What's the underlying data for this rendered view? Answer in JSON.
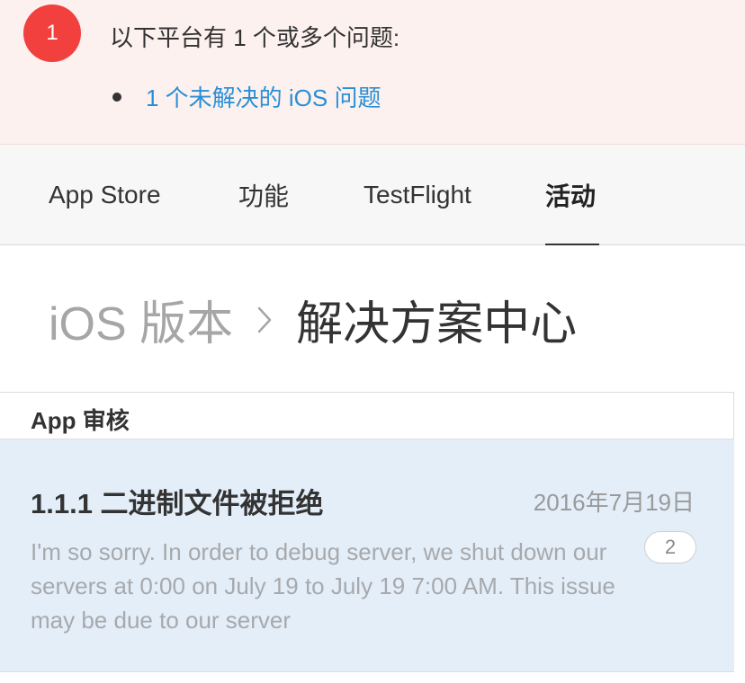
{
  "alert": {
    "badge_count": "1",
    "title": "以下平台有 1 个或多个问题:",
    "items": [
      {
        "label": "1 个未解决的 iOS 问题"
      }
    ]
  },
  "tabs": [
    {
      "label": "App Store",
      "active": false
    },
    {
      "label": "功能",
      "active": false
    },
    {
      "label": "TestFlight",
      "active": false
    },
    {
      "label": "活动",
      "active": true
    }
  ],
  "breadcrumb": {
    "parent": "iOS 版本",
    "current": "解决方案中心"
  },
  "section": {
    "title": "App 审核",
    "messages": [
      {
        "title": "1.1.1 二进制文件被拒绝",
        "date": "2016年7月19日",
        "body": "I'm so sorry. In order to debug server, we shut down our servers at 0:00 on July 19 to July 19 7:00 AM. This issue may be due to our server",
        "reply_count": "2"
      }
    ]
  },
  "colors": {
    "alert_background": "#fcf1ef",
    "badge": "#f2403e",
    "link": "#2a8fd6",
    "selected_row": "#e3eef9"
  }
}
